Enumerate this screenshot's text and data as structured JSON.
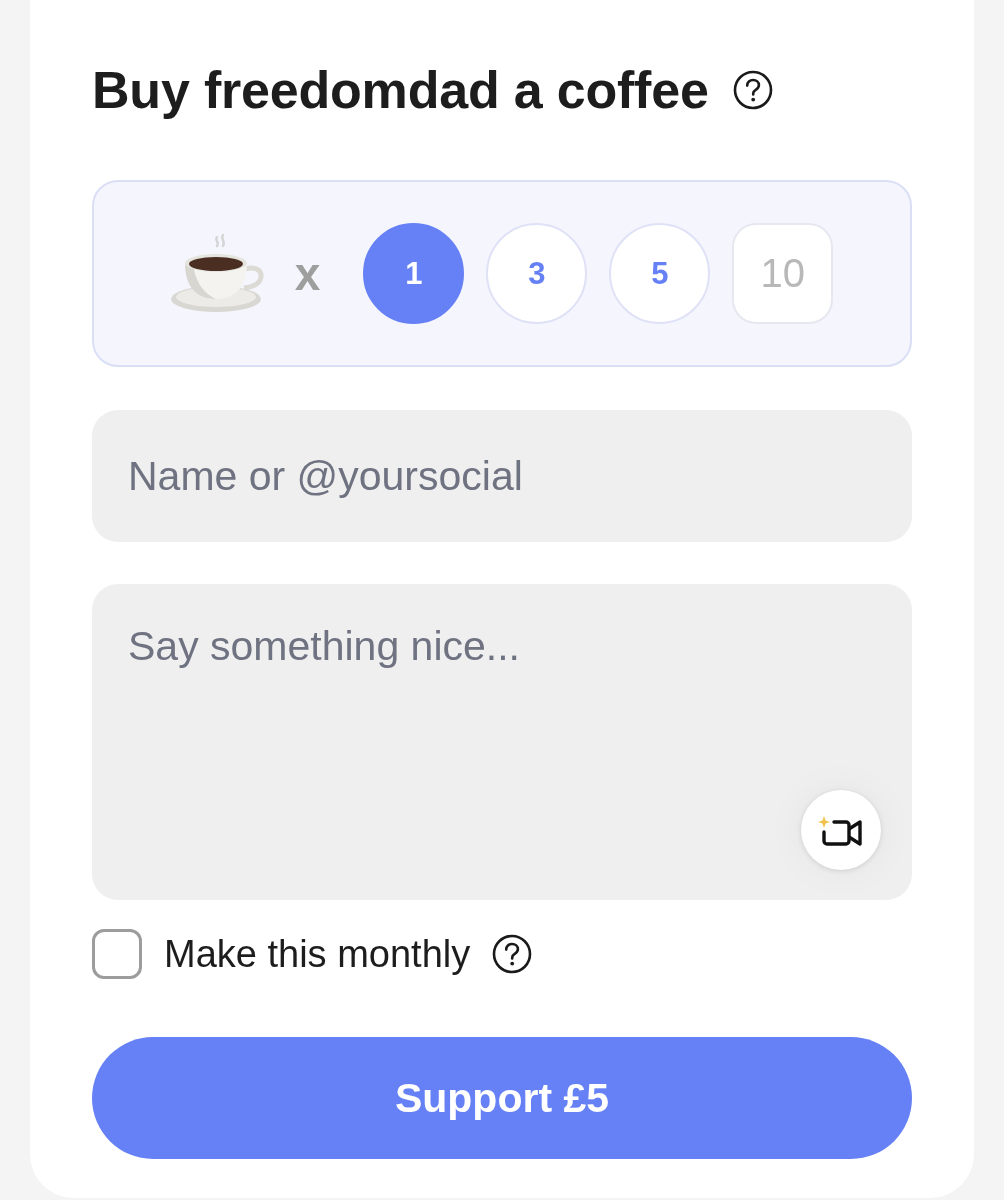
{
  "title": "Buy freedomdad a coffee",
  "quantity": {
    "multiplier": "x",
    "options": [
      {
        "label": "1",
        "selected": true
      },
      {
        "label": "3",
        "selected": false
      },
      {
        "label": "5",
        "selected": false
      }
    ],
    "custom": {
      "placeholder": "10"
    }
  },
  "name_field": {
    "placeholder": "Name or @yoursocial"
  },
  "message_field": {
    "placeholder": "Say something nice..."
  },
  "monthly": {
    "label": "Make this monthly",
    "checked": false
  },
  "submit": {
    "label": "Support £5"
  }
}
